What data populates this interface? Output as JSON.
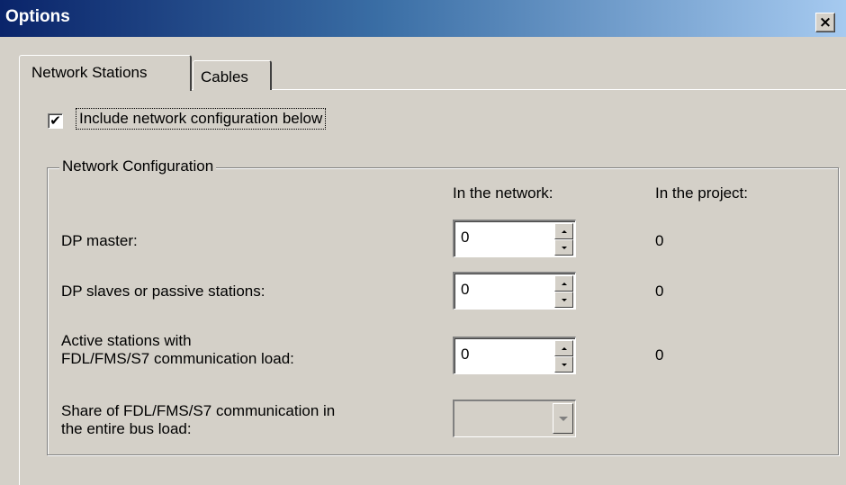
{
  "window": {
    "title": "Options",
    "close_glyph": "×"
  },
  "tabs": [
    {
      "label": "Network Stations",
      "active": true
    },
    {
      "label": "Cables",
      "active": false
    }
  ],
  "include_checkbox": {
    "label": "Include network configuration below",
    "checked": true,
    "glyph": "✔"
  },
  "network_config": {
    "group_title": "Network Configuration",
    "col_network": "In the network:",
    "col_project": "In the project:",
    "rows": [
      {
        "label_line1": "DP master:",
        "label_line2": "",
        "network_value": "0",
        "project_value": "0"
      },
      {
        "label_line1": "DP slaves or passive stations:",
        "label_line2": "",
        "network_value": "0",
        "project_value": "0"
      },
      {
        "label_line1": "Active stations with",
        "label_line2": "FDL/FMS/S7 communication load:",
        "network_value": "0",
        "project_value": "0"
      }
    ],
    "share": {
      "label_line1": "Share of FDL/FMS/S7 communication in",
      "label_line2": "the entire bus load:",
      "value": ""
    }
  },
  "icons": {
    "close": "close-icon",
    "spin_up": "spin-up-icon",
    "spin_down": "spin-down-icon",
    "dropdown": "chevron-down-icon"
  }
}
